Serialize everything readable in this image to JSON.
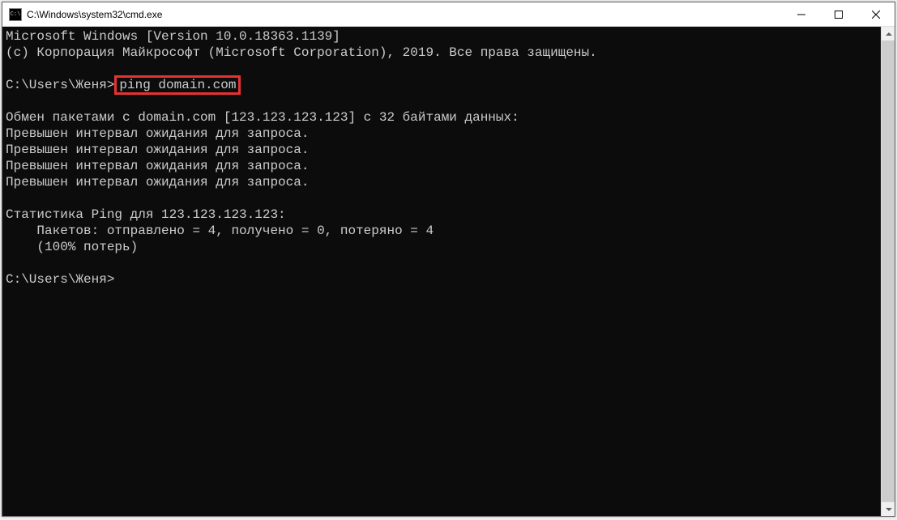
{
  "window": {
    "title": "C:\\Windows\\system32\\cmd.exe",
    "icon_label": "C:\\"
  },
  "terminal": {
    "line1": "Microsoft Windows [Version 10.0.18363.1139]",
    "line2": "(c) Корпорация Майкрософт (Microsoft Corporation), 2019. Все права защищены.",
    "blank1": "",
    "prompt1_pre": "C:\\Users\\Женя>",
    "prompt1_cmd": "ping domain.com",
    "blank2": "",
    "ping_header": "Обмен пакетами с domain.com [123.123.123.123] с 32 байтами данных:",
    "timeout1": "Превышен интервал ожидания для запроса.",
    "timeout2": "Превышен интервал ожидания для запроса.",
    "timeout3": "Превышен интервал ожидания для запроса.",
    "timeout4": "Превышен интервал ожидания для запроса.",
    "blank3": "",
    "stats_header": "Статистика Ping для 123.123.123.123:",
    "stats_packets": "    Пакетов: отправлено = 4, получено = 0, потеряно = 4",
    "stats_loss": "    (100% потерь)",
    "blank4": "",
    "prompt2": "C:\\Users\\Женя>"
  }
}
